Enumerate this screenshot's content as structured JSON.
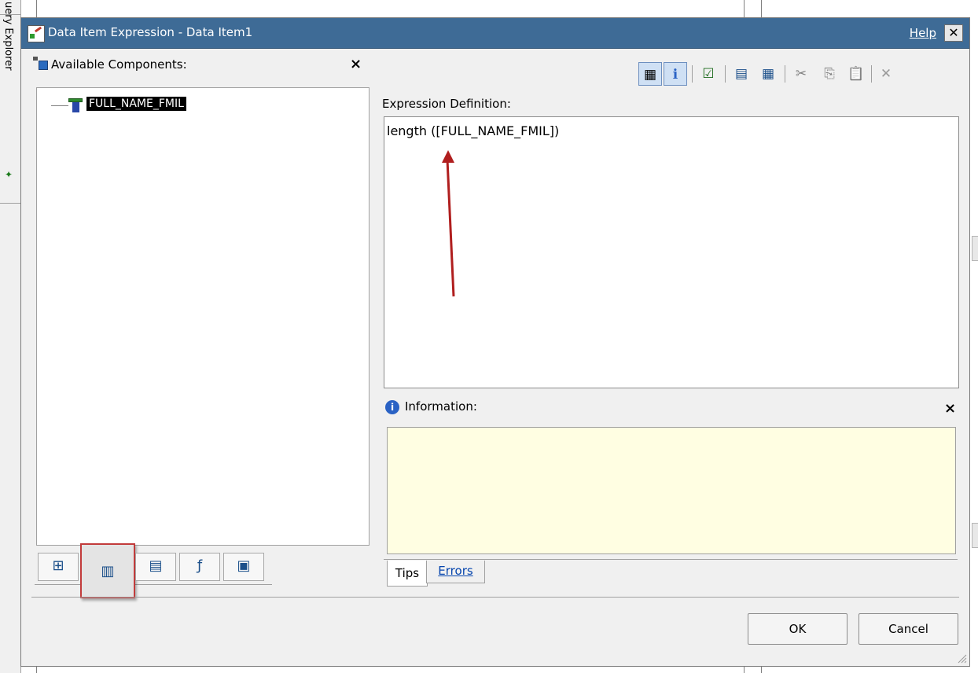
{
  "background": {
    "side_panel_label": "uery Explorer"
  },
  "dialog": {
    "title": "Data Item Expression - Data Item1",
    "help_label": "Help",
    "close_glyph": "✕"
  },
  "left_panel": {
    "header": "Available Components:",
    "close_glyph": "×",
    "tree": [
      {
        "label": "FULL_NAME_FMIL",
        "icon": "column-icon",
        "selected": true
      }
    ],
    "tabs": [
      {
        "name": "model-tab",
        "icon": "model-icon",
        "glyph": "⊞",
        "active": false
      },
      {
        "name": "data-items-tab",
        "icon": "column-icon",
        "glyph": "▥",
        "active": true
      },
      {
        "name": "query-items-tab",
        "icon": "query-icon",
        "glyph": "▤",
        "active": false
      },
      {
        "name": "functions-tab",
        "icon": "function-icon",
        "glyph": "ƒ",
        "active": false
      },
      {
        "name": "parameters-tab",
        "icon": "parameters-icon",
        "glyph": "▣",
        "active": false
      }
    ]
  },
  "toolbar": {
    "buttons": [
      {
        "name": "show-tree-button",
        "icon": "tree-icon",
        "glyph": "▦",
        "pressed": true
      },
      {
        "name": "info-button",
        "icon": "info-icon",
        "glyph": "ℹ",
        "pressed": true
      },
      {
        "name": "validate-button",
        "icon": "checkmark-icon",
        "glyph": "☑",
        "pressed": false
      },
      {
        "name": "insert-button",
        "icon": "insert-icon",
        "glyph": "▤",
        "pressed": false
      },
      {
        "name": "insert-alt-button",
        "icon": "insert-alt-icon",
        "glyph": "▦",
        "pressed": false
      },
      {
        "name": "cut-button",
        "icon": "scissors-icon",
        "glyph": "✂",
        "pressed": false
      },
      {
        "name": "copy-button",
        "icon": "copy-icon",
        "glyph": "⎘",
        "pressed": false
      },
      {
        "name": "paste-button",
        "icon": "paste-icon",
        "glyph": "📋",
        "pressed": false
      },
      {
        "name": "delete-button",
        "icon": "delete-icon",
        "glyph": "✕",
        "pressed": false
      }
    ]
  },
  "expression": {
    "label": "Expression Definition:",
    "value": "length ([FULL_NAME_FMIL])"
  },
  "information": {
    "label": "Information:",
    "close_glyph": "×",
    "tabs": {
      "tips": "Tips",
      "errors": "Errors"
    }
  },
  "buttons": {
    "ok": "OK",
    "cancel": "Cancel"
  },
  "colors": {
    "titlebar": "#3e6b96",
    "info_box": "#fffee2",
    "highlight": "#c23b3b"
  }
}
